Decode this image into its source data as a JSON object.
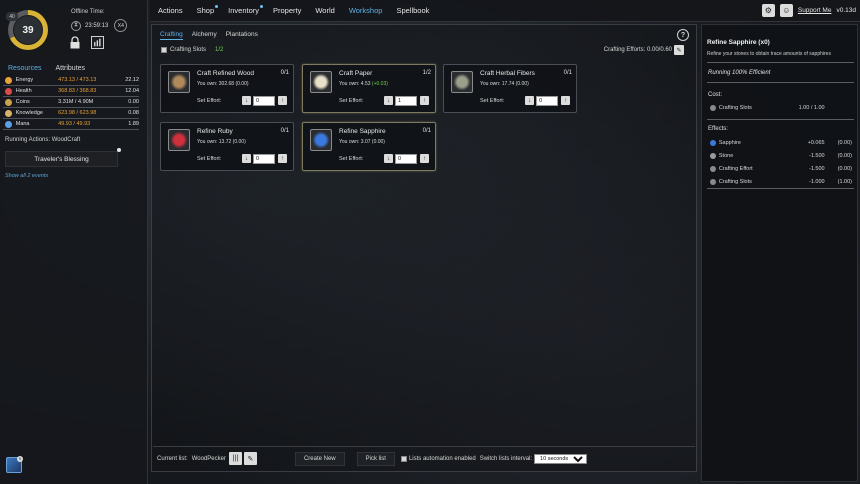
{
  "player": {
    "level": "39",
    "level_badge": "40",
    "level_progress": 0.68,
    "offline_label": "Offline Time:",
    "offline_time": "23:59:13",
    "speed_mult": "X4"
  },
  "left_tabs": [
    "Resources",
    "Attributes"
  ],
  "resources": [
    {
      "name": "Energy",
      "value": "473.13 / 473.13",
      "rate": "22.12",
      "color": "#e8a23a",
      "value_color": "#e8a23a"
    },
    {
      "name": "Health",
      "value": "368.83 / 368.83",
      "rate": "12.04",
      "color": "#d94b4b",
      "value_color": "#e8a23a"
    },
    {
      "name": "Coins",
      "value": "3.31M / 4.90M",
      "rate": "0.00",
      "color": "#c9a24a",
      "value_color": "#e0e0e0"
    },
    {
      "name": "Knowledge",
      "value": "623.98 / 623.98",
      "rate": "0.08",
      "color": "#d7b06a",
      "value_color": "#e8a23a"
    },
    {
      "name": "Mana",
      "value": "49.93 / 49.93",
      "rate": "1.89",
      "color": "#5aa0e6",
      "value_color": "#e8a23a"
    }
  ],
  "running_actions": "Running Actions: WoodCraft",
  "blessing": "Traveler's Blessing",
  "show_events": "Show all 2 events",
  "nav": {
    "items": [
      {
        "label": "Actions",
        "dot": false,
        "active": false
      },
      {
        "label": "Shop",
        "dot": true,
        "active": false
      },
      {
        "label": "Inventory",
        "dot": true,
        "active": false
      },
      {
        "label": "Property",
        "dot": false,
        "active": false
      },
      {
        "label": "World",
        "dot": false,
        "active": false
      },
      {
        "label": "Workshop",
        "dot": false,
        "active": true
      },
      {
        "label": "Spellbook",
        "dot": false,
        "active": false
      }
    ],
    "support": "Support Me",
    "version": "v0.13d"
  },
  "workshop": {
    "tabs": [
      "Crafting",
      "Alchemy",
      "Plantations"
    ],
    "crafting_slots_label": "Crafting Slots",
    "crafting_slots_value": "1/2",
    "efforts_label": "Crafting Efforts: 0.00/0.60",
    "set_effort_label": "Set Effort:",
    "cards": [
      {
        "title": "Craft Refined Wood",
        "count": "0/1",
        "own": "You own: 302.68 (0.00)",
        "gain": "",
        "effort": "0",
        "icon": "wood-icon",
        "icon_color": "#b08a5a",
        "selected": false
      },
      {
        "title": "Craft Paper",
        "count": "1/2",
        "own": "You own: 4.53",
        "gain": "(+0.03)",
        "effort": "1",
        "icon": "paper-icon",
        "icon_color": "#e8e0c8",
        "selected": true
      },
      {
        "title": "Craft Herbal Fibers",
        "count": "0/1",
        "own": "You own: 17.74 (0.00)",
        "gain": "",
        "effort": "0",
        "icon": "herb-icon",
        "icon_color": "#9aa08a",
        "selected": false
      },
      {
        "title": "Refine Ruby",
        "count": "0/1",
        "own": "You own: 13.72 (0.00)",
        "gain": "",
        "effort": "0",
        "icon": "ruby-icon",
        "icon_color": "#d0303c",
        "selected": false
      },
      {
        "title": "Refine Sapphire",
        "count": "0/1",
        "own": "You own: 3.07 (0.00)",
        "gain": "",
        "effort": "0",
        "icon": "sapphire-icon",
        "icon_color": "#3a7ae0",
        "selected": true
      }
    ]
  },
  "footer": {
    "current_list_label": "Current list:",
    "current_list": "WoodPecker",
    "create_new": "Create New",
    "pick_list": "Pick list",
    "automation": "Lists automation enabled",
    "interval_label": "Switch lists interval:",
    "interval_value": "10 seconds"
  },
  "detail": {
    "title": "Refine Sapphire (x0)",
    "desc": "Refine your stones to obtain trace amounts of sapphires",
    "efficiency": "Running 100% Efficient",
    "cost_label": "Cost:",
    "cost": [
      {
        "name": "Crafting Slots",
        "v1": "1.00 / 1.00",
        "v2": "",
        "color": "#8a8a8a"
      }
    ],
    "effects_label": "Effects:",
    "effects": [
      {
        "name": "Sapphire",
        "v1": "+0.065",
        "v2": "(0.00)",
        "color": "#3a7ae0"
      },
      {
        "name": "Stone",
        "v1": "-1.500",
        "v2": "(0.00)",
        "color": "#9a9a9a"
      },
      {
        "name": "Crafting Effort",
        "v1": "-1.500",
        "v2": "(0.00)",
        "color": "#8a8a8a"
      },
      {
        "name": "Crafting Slots",
        "v1": "-1.000",
        "v2": "(1.00)",
        "color": "#8a8a8a"
      }
    ]
  }
}
